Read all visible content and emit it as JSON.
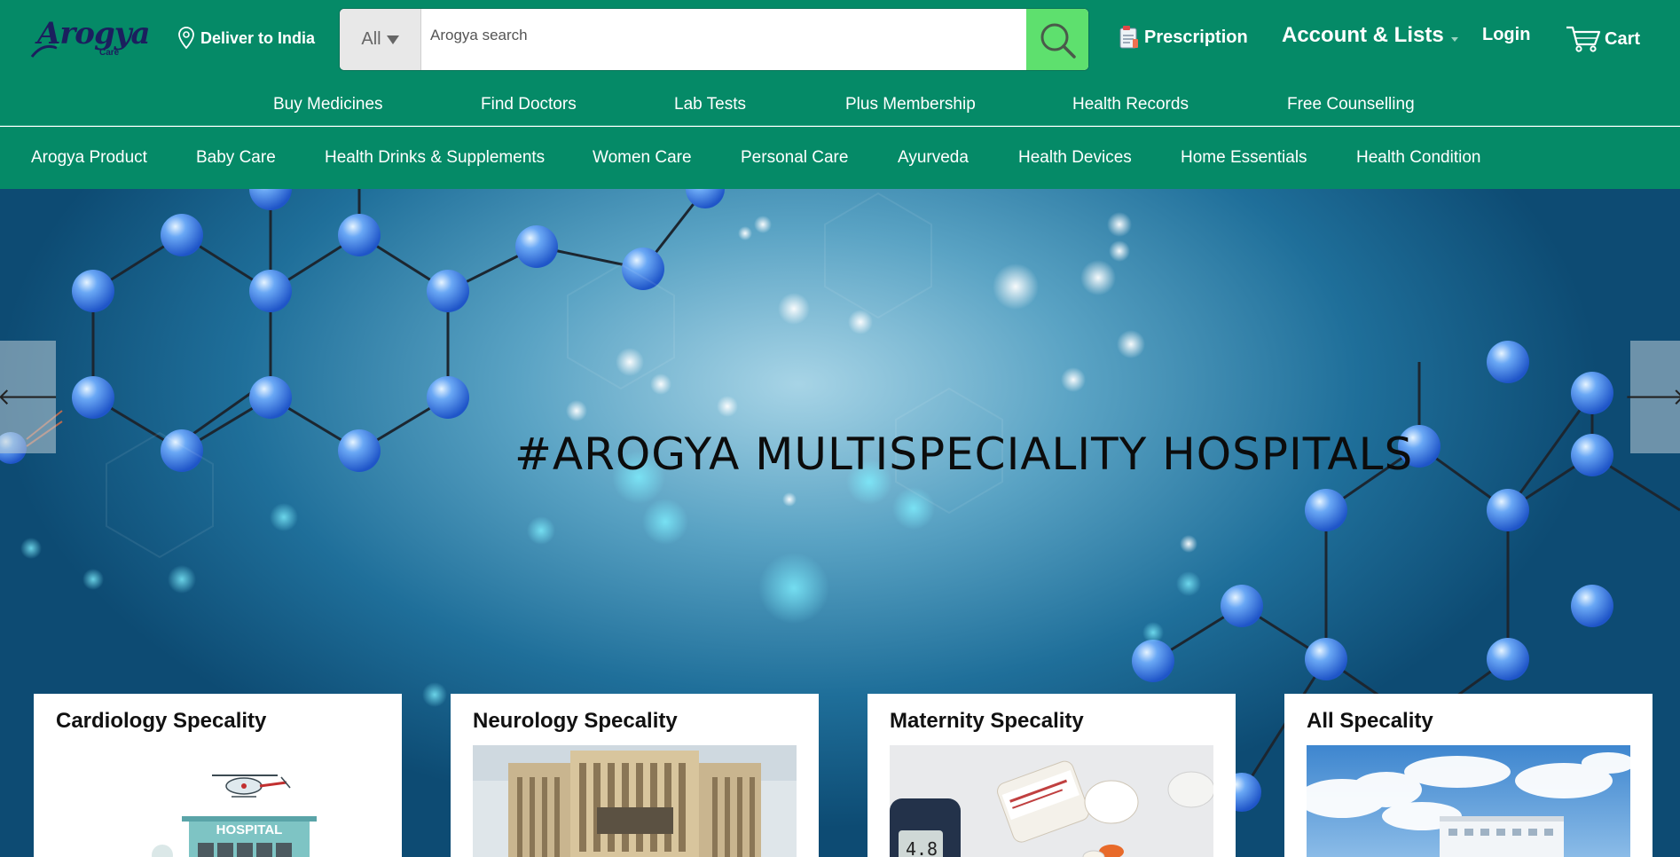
{
  "header": {
    "logo_text": "Arogya",
    "logo_sub": "Care",
    "deliver_label": "Deliver to India",
    "search": {
      "category": "All",
      "placeholder": "Arogya search"
    },
    "prescription_label": "Prescription",
    "account_label": "Account & Lists",
    "login_label": "Login",
    "cart_label": "Cart"
  },
  "service_nav": [
    "Buy Medicines",
    "Find Doctors",
    "Lab Tests",
    "Plus Membership",
    "Health Records",
    "Free Counselling"
  ],
  "category_nav": [
    "Arogya Product",
    "Baby Care",
    "Health Drinks & Supplements",
    "Women Care",
    "Personal Care",
    "Ayurveda",
    "Health Devices",
    "Home Essentials",
    "Health Condition"
  ],
  "hero": {
    "title": "#AROGYA MULTISPECIALITY HOSPITALS",
    "prev_icon": "arrow-left-icon",
    "next_icon": "arrow-right-icon"
  },
  "cards": [
    {
      "title": "Cardiology Specality",
      "image_label": "HOSPITAL"
    },
    {
      "title": "Neurology Specality"
    },
    {
      "title": "Maternity Specality",
      "image_label": "4.8"
    },
    {
      "title": "All Specality"
    }
  ],
  "colors": {
    "brand_green": "#058a67",
    "search_button": "#5ee06e",
    "logo_navy": "#1b1f5e"
  }
}
